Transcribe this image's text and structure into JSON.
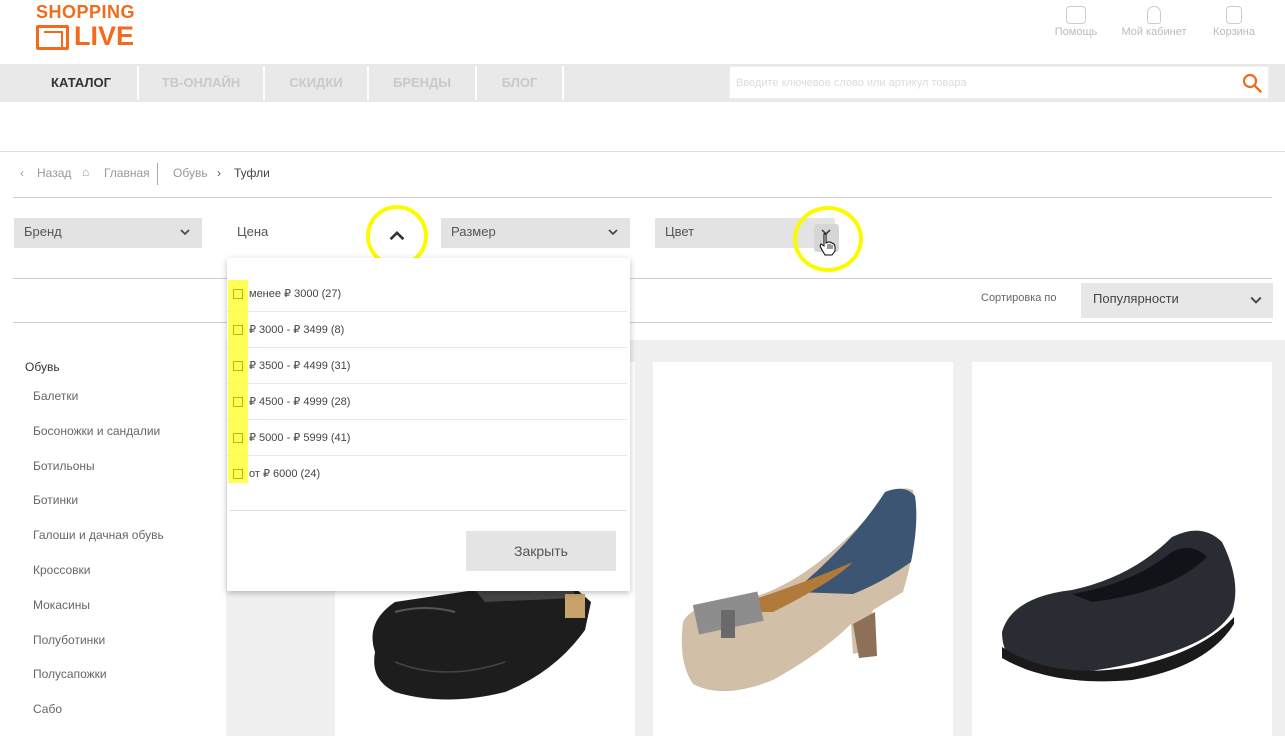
{
  "logo": {
    "line1": "SHOPPING",
    "line2": "LIVE"
  },
  "header_icons": [
    {
      "name": "help-icon",
      "label": "Помощь"
    },
    {
      "name": "account-icon",
      "label": "Мой кабинет"
    },
    {
      "name": "cart-icon",
      "label": "Корзина"
    }
  ],
  "nav": {
    "items": [
      "КАТАЛОГ",
      "ТВ-ОНЛАЙН",
      "СКИДКИ",
      "БРЕНДЫ",
      "БЛОГ"
    ]
  },
  "search": {
    "placeholder": "Введите ключевое слово или артикул товара"
  },
  "breadcrumb": {
    "back": "Назад",
    "home": "Главная",
    "level1": "Обувь",
    "current": "Туфли"
  },
  "filters": {
    "brand": "Бренд",
    "price": "Цена",
    "size": "Размер",
    "color": "Цвет"
  },
  "price_options": [
    "менее ₽ 3000 (27)",
    "₽ 3000 - ₽ 3499 (8)",
    "₽ 3500 - ₽ 4499 (31)",
    "₽ 4500 - ₽ 4999 (28)",
    "₽ 5000 - ₽ 5999 (41)",
    "от ₽ 6000 (24)"
  ],
  "close_label": "Закрыть",
  "sort": {
    "label": "Сортировка по",
    "value": "Популярности"
  },
  "sidebar": {
    "title": "Обувь",
    "items": [
      "Балетки",
      "Босоножки и сандалии",
      "Ботильоны",
      "Ботинки",
      "Галоши и дачная обувь",
      "Кроссовки",
      "Мокасины",
      "Полуботинки",
      "Полусапожки",
      "Сабо"
    ]
  },
  "colors": {
    "accent": "#f26b1d",
    "highlight": "#fbfb00"
  }
}
